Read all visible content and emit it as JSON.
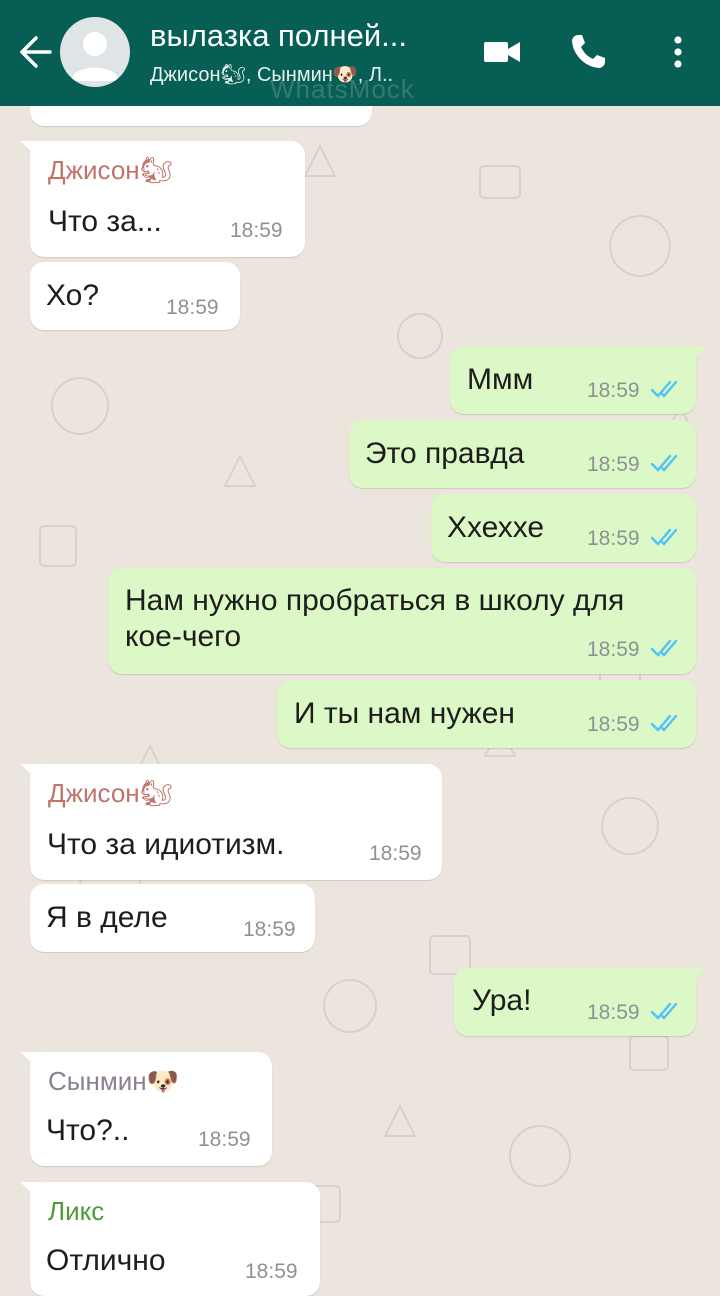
{
  "header": {
    "title": "вылазка полней...",
    "subtitle": "Джисон🐿, Сынмин🐶, Л..",
    "watermark": "WhatsMock",
    "icons": [
      "back-arrow-icon",
      "group-avatar-icon",
      "video-call-icon",
      "phone-icon",
      "more-vert-icon"
    ]
  },
  "colors": {
    "header": "#075e54",
    "chat_bg": "#ece5dd",
    "incoming": "#ffffff",
    "outgoing": "#dcf8c6",
    "read_ticks": "#4fc3f7",
    "sender_jisung": "#c0756b",
    "sender_seungmin": "#8a7f93",
    "sender_lix": "#4c9a3a"
  },
  "messages": [
    {
      "sender": "Джисон🐿",
      "text": "Что за...",
      "time": "18:59"
    },
    {
      "text": "Хо?",
      "time": "18:59"
    },
    {
      "text": "Ммм",
      "time": "18:59"
    },
    {
      "text": "Это правда",
      "time": "18:59"
    },
    {
      "text": "Ххеххе",
      "time": "18:59"
    },
    {
      "text_line1": "Нам нужно пробраться в школу для",
      "text_line2": "кое-чего",
      "time": "18:59"
    },
    {
      "text": "И ты нам нужен",
      "time": "18:59"
    },
    {
      "sender": "Джисон🐿",
      "text": "Что за идиотизм.",
      "time": "18:59"
    },
    {
      "text": "Я в деле",
      "time": "18:59"
    },
    {
      "text": "Ура!",
      "time": "18:59"
    },
    {
      "sender": "Сынмин🐶",
      "text": "Что?..",
      "time": "18:59"
    },
    {
      "sender": "Ликс",
      "text": "Отлично",
      "time": "18:59"
    }
  ]
}
